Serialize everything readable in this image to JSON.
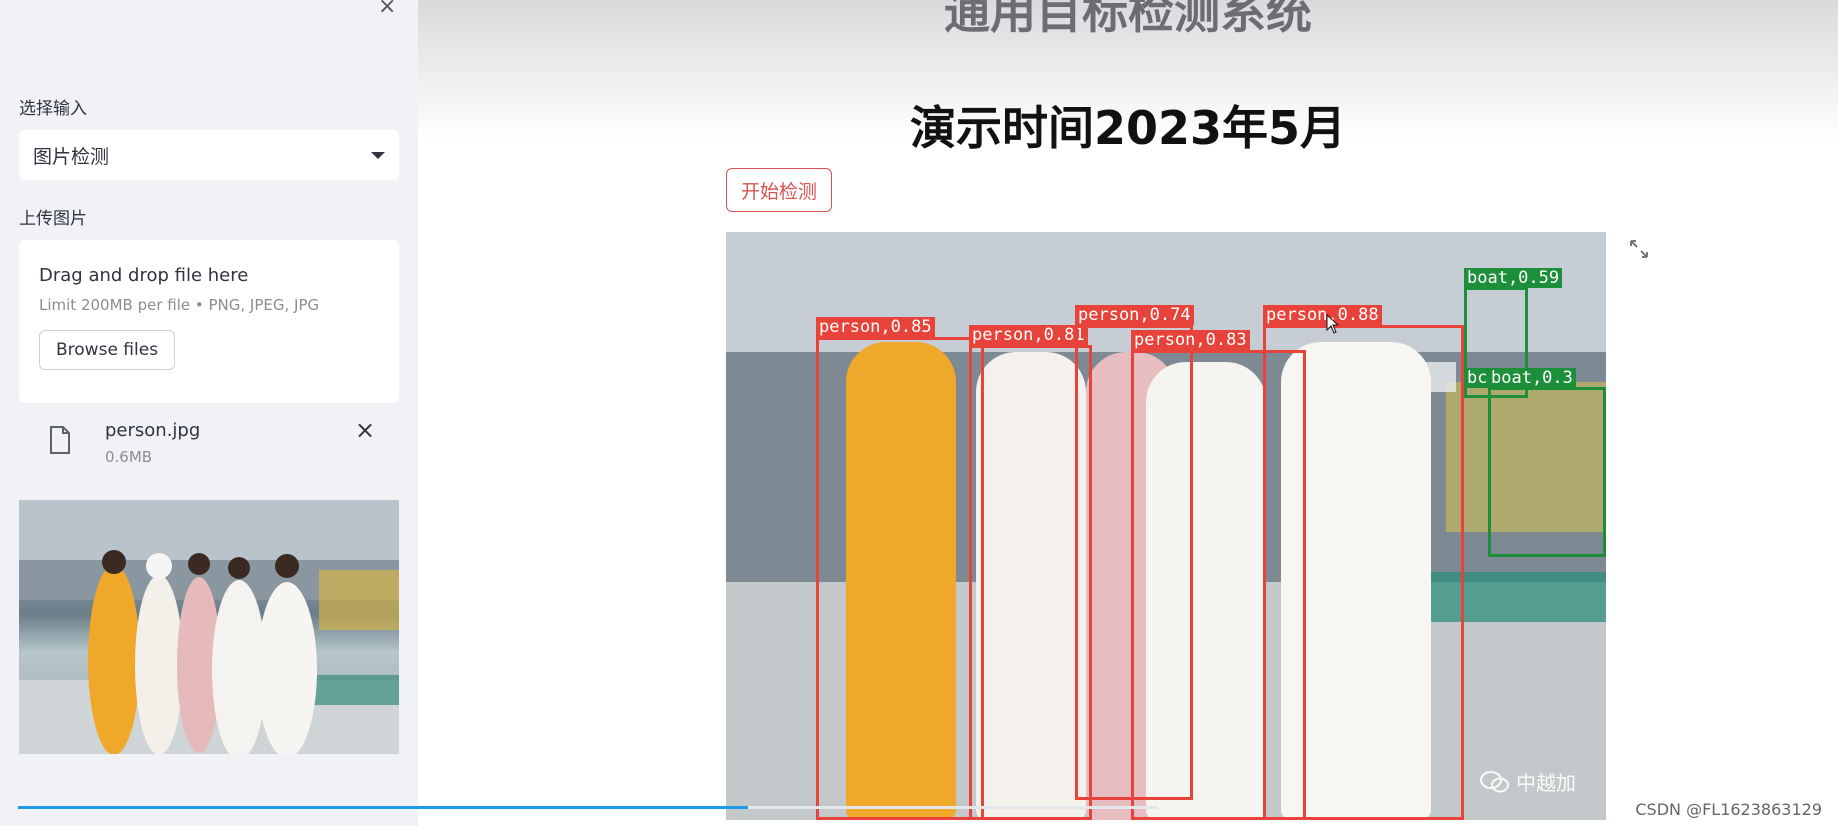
{
  "sidebar": {
    "close_glyph": "×",
    "input_label": "选择输入",
    "input_select": {
      "value": "图片检测",
      "icon": "chevron-down-icon"
    },
    "upload_label": "上传图片",
    "uploader": {
      "title": "Drag and drop file here",
      "limit": "Limit 200MB per file • PNG, JPEG, JPG",
      "browse_label": "Browse files"
    },
    "file": {
      "name": "person.jpg",
      "size": "0.6MB",
      "icon": "file-icon",
      "delete_glyph": "×"
    }
  },
  "main": {
    "title_partial": "通用目标检测系统",
    "subtitle": "演示时间2023年5月",
    "start_button": "开始检测",
    "detections": [
      {
        "label": "person,0.85",
        "class": "person"
      },
      {
        "label": "person,0.81",
        "class": "person"
      },
      {
        "label": "person,0.74",
        "class": "person"
      },
      {
        "label": "person,0.83",
        "class": "person"
      },
      {
        "label": "person,0.88",
        "class": "person"
      },
      {
        "label": "boat,0.59",
        "class": "boat"
      },
      {
        "label": "bc",
        "class": "boat"
      },
      {
        "label": "boat,0.3",
        "class": "boat"
      }
    ],
    "watermark": "中越加",
    "expand_icon": "expand-icon"
  },
  "footer": {
    "csdn": "CSDN @FL1623863129"
  },
  "colors": {
    "accent_red": "#e8433a",
    "accent_green": "#1d8f3a",
    "progress_blue": "#1c9be6",
    "sidebar_bg": "#f0f2f6"
  }
}
